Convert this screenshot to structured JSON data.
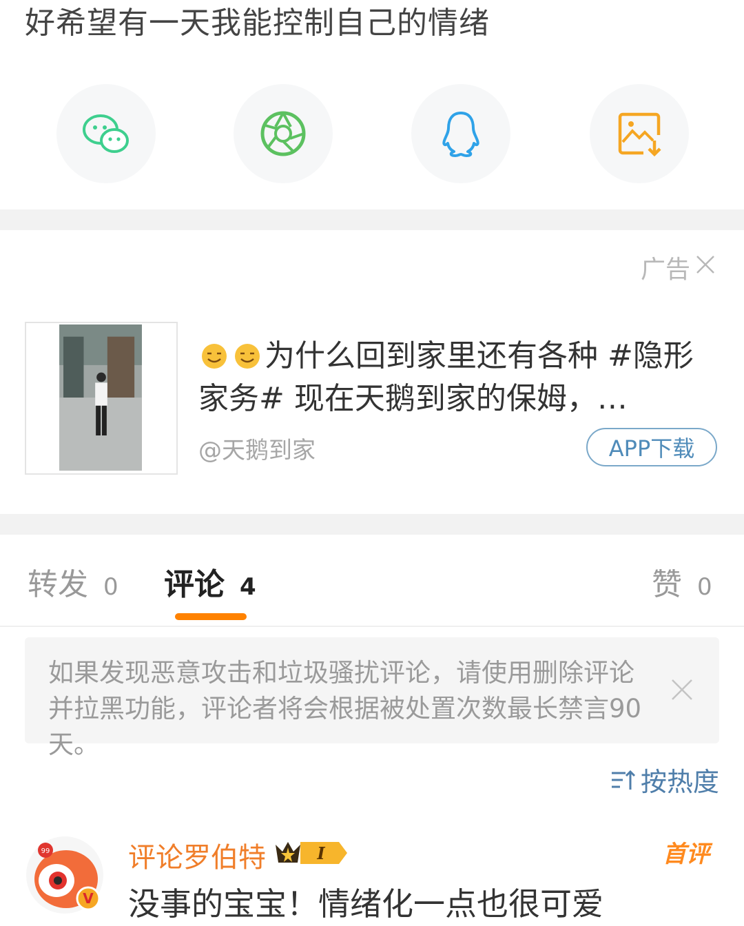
{
  "post": {
    "text": "好希望有一天我能控制自己的情绪"
  },
  "share": {
    "items": [
      {
        "icon": "wechat-icon"
      },
      {
        "icon": "moments-icon"
      },
      {
        "icon": "qq-icon"
      },
      {
        "icon": "save-image-icon"
      }
    ]
  },
  "ad": {
    "label": "广告",
    "text": "为什么回到家里还有各种 #隐形家务# 现在天鹅到家的保姆，…",
    "source": "@天鹅到家",
    "button": "APP下载"
  },
  "tabs": {
    "repost": {
      "label": "转发",
      "count": "0"
    },
    "comment": {
      "label": "评论",
      "count": "4"
    },
    "like": {
      "label": "赞",
      "count": "0"
    }
  },
  "notice": {
    "text": "如果发现恶意攻击和垃圾骚扰评论，请使用删除评论并拉黑功能，评论者将会根据被处置次数最长禁言90天。"
  },
  "sort": {
    "label": "按热度"
  },
  "comment": {
    "author": "评论罗伯特",
    "level": "I",
    "badge": "首评",
    "avatar_badge": "99",
    "text": "没事的宝宝！情绪化一点也很可爱"
  },
  "colors": {
    "accent": "#ff8200",
    "username": "#f07e2a",
    "link": "#4f7eaa",
    "wechat": "#3ecf8e",
    "moments": "#5cc160",
    "qq": "#2fa2e8",
    "save": "#f5a623"
  }
}
